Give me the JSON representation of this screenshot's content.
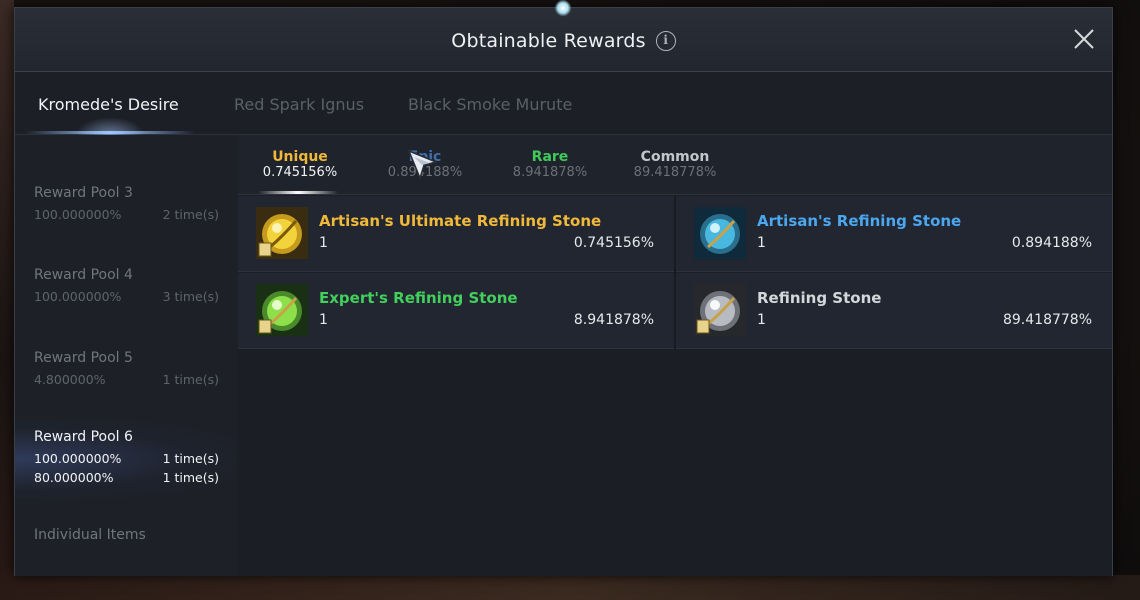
{
  "dialog": {
    "title": "Obtainable Rewards",
    "info_icon": "info-icon",
    "close_icon": "close-icon"
  },
  "boss_tabs": [
    {
      "label": "Kromede's Desire",
      "active": true
    },
    {
      "label": "Red Spark Ignus",
      "active": false
    },
    {
      "label": "Black Smoke Murute",
      "active": false
    }
  ],
  "reward_pools": [
    {
      "title": "Reward Pool 3",
      "rows": [
        {
          "pct": "100.000000%",
          "times": "2 time(s)"
        }
      ],
      "active": false
    },
    {
      "title": "Reward Pool 4",
      "rows": [
        {
          "pct": "100.000000%",
          "times": "3 time(s)"
        }
      ],
      "active": false
    },
    {
      "title": "Reward Pool 5",
      "rows": [
        {
          "pct": "4.800000%",
          "times": "1 time(s)"
        }
      ],
      "active": false
    },
    {
      "title": "Reward Pool 6",
      "rows": [
        {
          "pct": "100.000000%",
          "times": "1 time(s)"
        },
        {
          "pct": "80.000000%",
          "times": "1 time(s)"
        }
      ],
      "active": true
    }
  ],
  "individual_items": "Individual Items",
  "rarities": [
    {
      "name": "Unique",
      "pct": "0.745156%",
      "active": true
    },
    {
      "name": "Epic",
      "pct": "0.894188%",
      "active": false
    },
    {
      "name": "Rare",
      "pct": "8.941878%",
      "active": false
    },
    {
      "name": "Common",
      "pct": "89.418778%",
      "active": false
    }
  ],
  "items": [
    {
      "name": "Artisan's Ultimate Refining Stone",
      "qty": "1",
      "chance": "0.745156%",
      "rarity": "unique",
      "icon": "gold-refining-stone-icon"
    },
    {
      "name": "Artisan's Refining Stone",
      "qty": "1",
      "chance": "0.894188%",
      "rarity": "epic",
      "icon": "blue-refining-stone-icon"
    },
    {
      "name": "Expert's Refining Stone",
      "qty": "1",
      "chance": "8.941878%",
      "rarity": "rare",
      "icon": "green-refining-stone-icon"
    },
    {
      "name": "Refining Stone",
      "qty": "1",
      "chance": "89.418778%",
      "rarity": "common",
      "icon": "gray-refining-stone-icon"
    }
  ],
  "colors": {
    "unique": "#f0b93a",
    "epic": "#4aa7f0",
    "rare": "#42cf5c",
    "common": "#d4d7dc",
    "panel": "#1b1e25"
  }
}
